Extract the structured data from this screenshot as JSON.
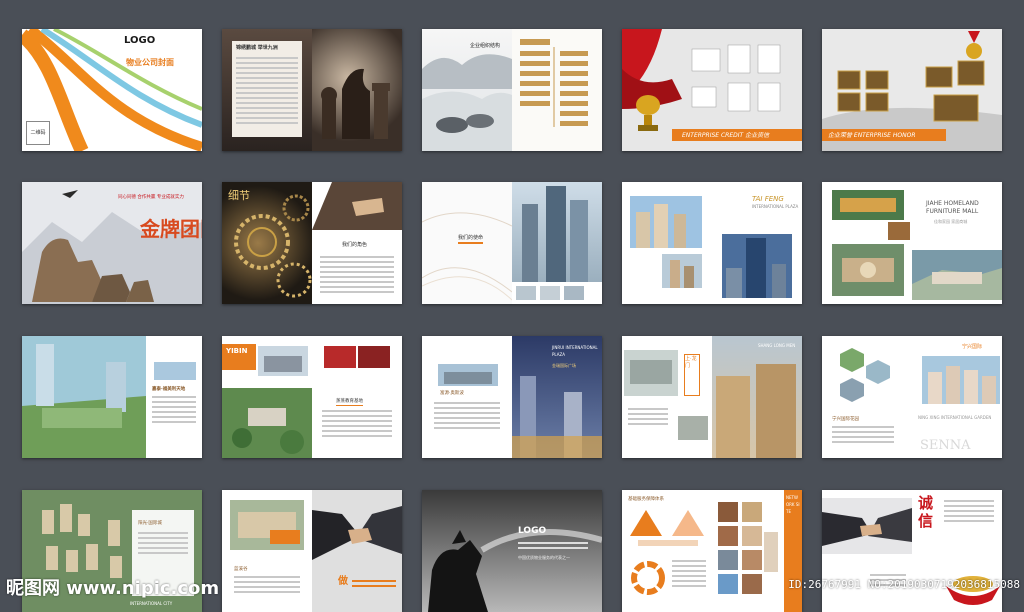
{
  "watermark": {
    "site": "昵图网 www.nipic.com",
    "id": "ID:26767991 NO:20190307192036815088"
  },
  "colors": {
    "background": "#4a4f57",
    "orange": "#e87d1e",
    "red": "#c8161d",
    "brown": "#8b5a2b"
  },
  "row1": {
    "cover_logo": "LOGO",
    "cover_title": "物业公司封面",
    "cover_qr": "二维码",
    "chess_heading": "锦绣鹏城 举世九洲",
    "credit_band": "ENTERPRISE CREDIT 企业资信",
    "honor_band": "企业荣誉 ENTERPRISE HONOR"
  },
  "row2": {
    "wolf_slogan": "同心同德 合作共赢 专业成就实力",
    "wolf_title": "金牌团队",
    "gear_title": "细节",
    "gear_caption": "我们的角色",
    "taifeng_title": "TAI FENG",
    "taifeng_sub": "INTERNATIONAL PLAZA",
    "jiahe_title": "JIAHE HOMELAND",
    "jiahe_sub": "FURNITURE MALL",
    "jiahe_cn": "佳和家园 家居商城"
  },
  "row3": {
    "green_label": "嘉泰·福美利天地",
    "yibin_title": "YIBIN",
    "yibin_caption": "蒸蒸教育基地",
    "jinrui_title": "JINRUI INTERNATIONAL PLAZA",
    "jinrui_cn": "金瑞国际广场",
    "shang_title": "SHANG LONG MEN",
    "shang_cn": "上·龙门",
    "senna_title": "SENNA",
    "senna_sub": "NING XING INTERNATIONAL GARDEN",
    "senna_cn": "宁兴国际"
  },
  "row4": {
    "aerial_caption": "INTERNATIONAL CITY",
    "aerial_label": "阳光·国际城",
    "hands_slogan": "做",
    "horse_logo": "LOGO",
    "horse_caption": "中国优质物业服务的代表之一",
    "team_heading": "基础服务保障体系",
    "network_title": "NETWORK SITE",
    "integrity_title": "诚信"
  }
}
